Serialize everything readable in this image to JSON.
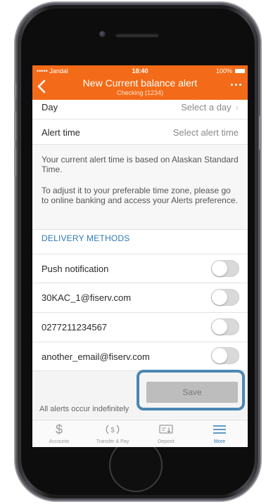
{
  "status_bar": {
    "carrier": "••••• Jandal",
    "time": "18:40",
    "battery": "100%"
  },
  "nav": {
    "title": "New Current balance alert",
    "subtitle": "Checking (1234)"
  },
  "settings": {
    "day": {
      "label": "Day",
      "value": "Select a day"
    },
    "alert_time": {
      "label": "Alert time",
      "value": "Select alert time"
    }
  },
  "info": {
    "line1": "Your current alert time is based on Alaskan Standard Time.",
    "line2": "To adjust it to your preferable time zone, please go to online banking and access your Alerts preference."
  },
  "delivery": {
    "header": "DELIVERY METHODS",
    "items": [
      {
        "label": "Push notification",
        "enabled": false
      },
      {
        "label": "30KAC_1@fiserv.com",
        "enabled": false
      },
      {
        "label": "0277211234567",
        "enabled": false
      },
      {
        "label": "another_email@fiserv.com",
        "enabled": false
      }
    ]
  },
  "save_label": "Save",
  "footnote": "All alerts occur indefinitely",
  "tabs": [
    {
      "label": "Accounts",
      "icon": "dollar-icon"
    },
    {
      "label": "Transfer & Pay",
      "icon": "transfer-pay-icon"
    },
    {
      "label": "Deposit",
      "icon": "deposit-check-icon"
    },
    {
      "label": "More",
      "icon": "hamburger-menu-icon",
      "active": true
    }
  ],
  "colors": {
    "brand_orange": "#f36b18",
    "link_blue": "#2f78b6",
    "highlight_blue": "#4b87b3"
  }
}
